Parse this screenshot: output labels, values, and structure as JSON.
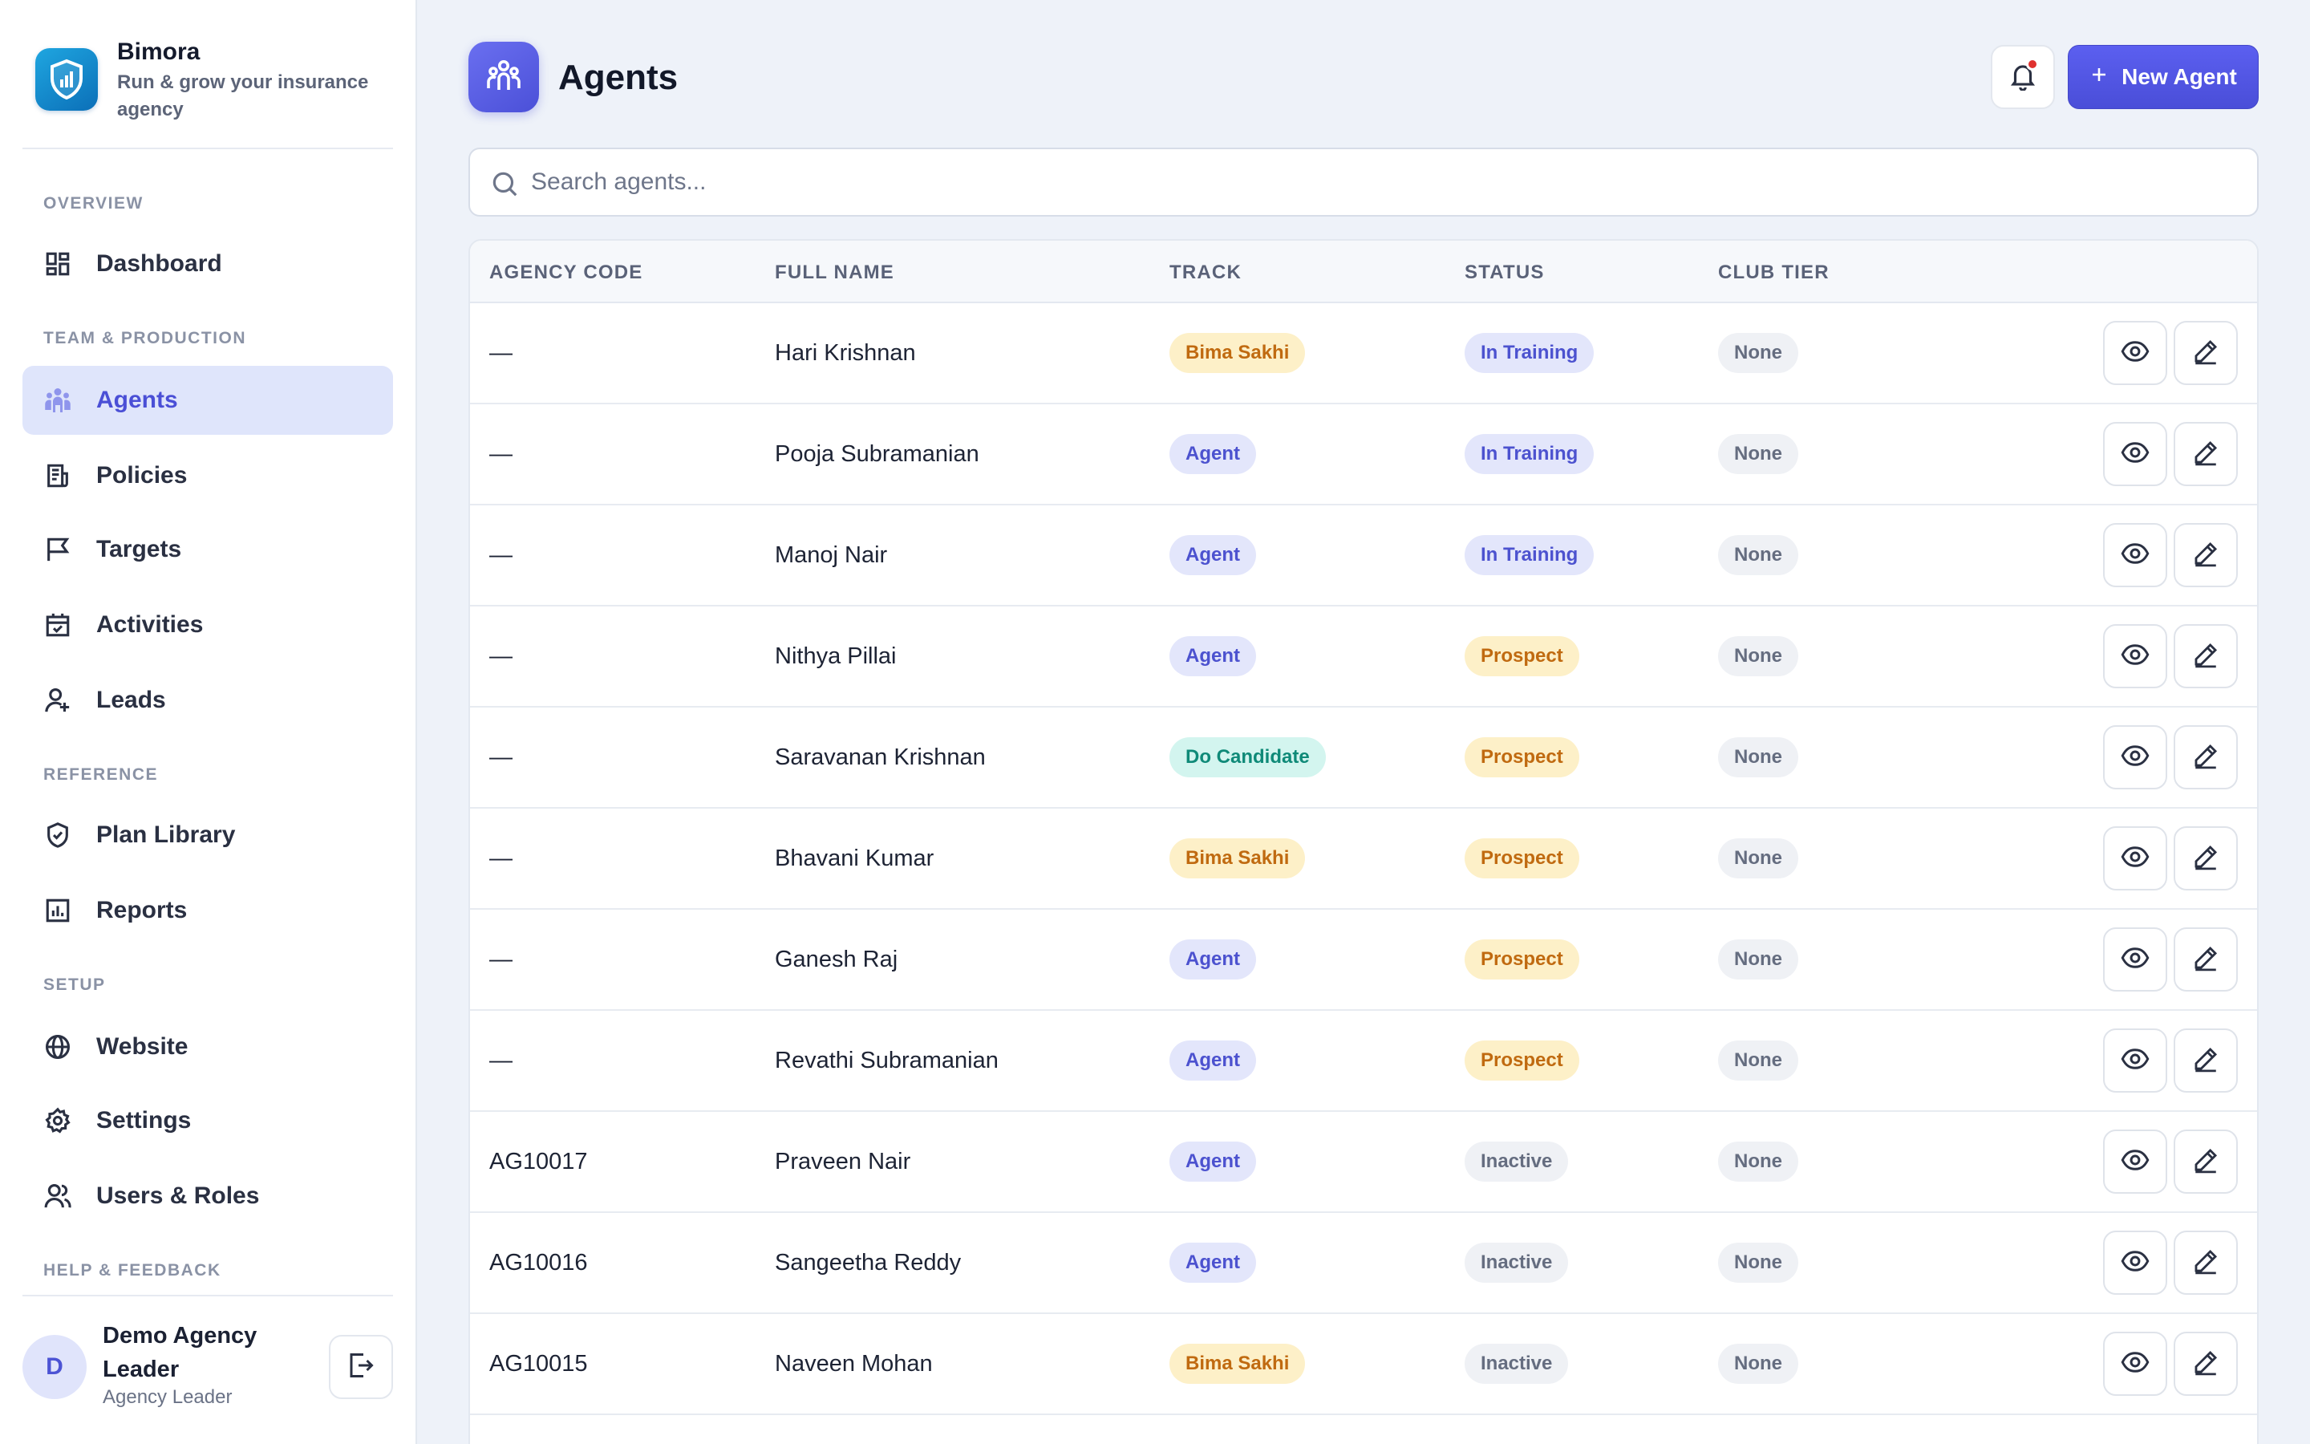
{
  "app": {
    "name": "Bimora",
    "tagline": "Run & grow your insurance agency"
  },
  "sidebar": {
    "sections": [
      {
        "label": "OVERVIEW"
      },
      {
        "label": "TEAM & PRODUCTION"
      },
      {
        "label": "REFERENCE"
      },
      {
        "label": "SETUP"
      },
      {
        "label": "HELP & FEEDBACK"
      }
    ],
    "items": [
      {
        "label": "Dashboard",
        "icon": "dashboard-icon"
      },
      {
        "label": "Agents",
        "icon": "agents-icon",
        "active": true
      },
      {
        "label": "Policies",
        "icon": "document-icon"
      },
      {
        "label": "Targets",
        "icon": "flag-icon"
      },
      {
        "label": "Activities",
        "icon": "calendar-check-icon"
      },
      {
        "label": "Leads",
        "icon": "user-plus-icon"
      },
      {
        "label": "Plan Library",
        "icon": "shield-check-icon"
      },
      {
        "label": "Reports",
        "icon": "bar-chart-icon"
      },
      {
        "label": "Website",
        "icon": "globe-icon"
      },
      {
        "label": "Settings",
        "icon": "gear-icon"
      },
      {
        "label": "Users & Roles",
        "icon": "users-icon"
      }
    ]
  },
  "user": {
    "initial": "D",
    "name": "Demo Agency Leader",
    "role": "Agency Leader"
  },
  "header": {
    "title": "Agents",
    "new_button_label": "New Agent",
    "notification_unread": true
  },
  "search": {
    "placeholder": "Search agents...",
    "value": ""
  },
  "table": {
    "columns": [
      "AGENCY CODE",
      "FULL NAME",
      "TRACK",
      "STATUS",
      "CLUB TIER"
    ],
    "rows": [
      {
        "code": "—",
        "name": "Hari Krishnan",
        "track": "Bima Sakhi",
        "status": "In Training",
        "tier": "None"
      },
      {
        "code": "—",
        "name": "Pooja Subramanian",
        "track": "Agent",
        "status": "In Training",
        "tier": "None"
      },
      {
        "code": "—",
        "name": "Manoj Nair",
        "track": "Agent",
        "status": "In Training",
        "tier": "None"
      },
      {
        "code": "—",
        "name": "Nithya Pillai",
        "track": "Agent",
        "status": "Prospect",
        "tier": "None"
      },
      {
        "code": "—",
        "name": "Saravanan Krishnan",
        "track": "Do Candidate",
        "status": "Prospect",
        "tier": "None"
      },
      {
        "code": "—",
        "name": "Bhavani Kumar",
        "track": "Bima Sakhi",
        "status": "Prospect",
        "tier": "None"
      },
      {
        "code": "—",
        "name": "Ganesh Raj",
        "track": "Agent",
        "status": "Prospect",
        "tier": "None"
      },
      {
        "code": "—",
        "name": "Revathi Subramanian",
        "track": "Agent",
        "status": "Prospect",
        "tier": "None"
      },
      {
        "code": "AG10017",
        "name": "Praveen Nair",
        "track": "Agent",
        "status": "Inactive",
        "tier": "None"
      },
      {
        "code": "AG10016",
        "name": "Sangeetha Reddy",
        "track": "Agent",
        "status": "Inactive",
        "tier": "None"
      },
      {
        "code": "AG10015",
        "name": "Naveen Mohan",
        "track": "Bima Sakhi",
        "status": "Inactive",
        "tier": "None"
      }
    ]
  },
  "colors": {
    "accent": "#4f54e0",
    "track_bima_sakhi": "#fdf0c8",
    "track_agent": "#e3e6fb",
    "track_do_candidate": "#d3f5ef",
    "status_in_training": "#e3e6fb",
    "status_prospect": "#fdf0c8",
    "status_inactive": "#eff1f5",
    "notification_dot": "#e0312f"
  }
}
